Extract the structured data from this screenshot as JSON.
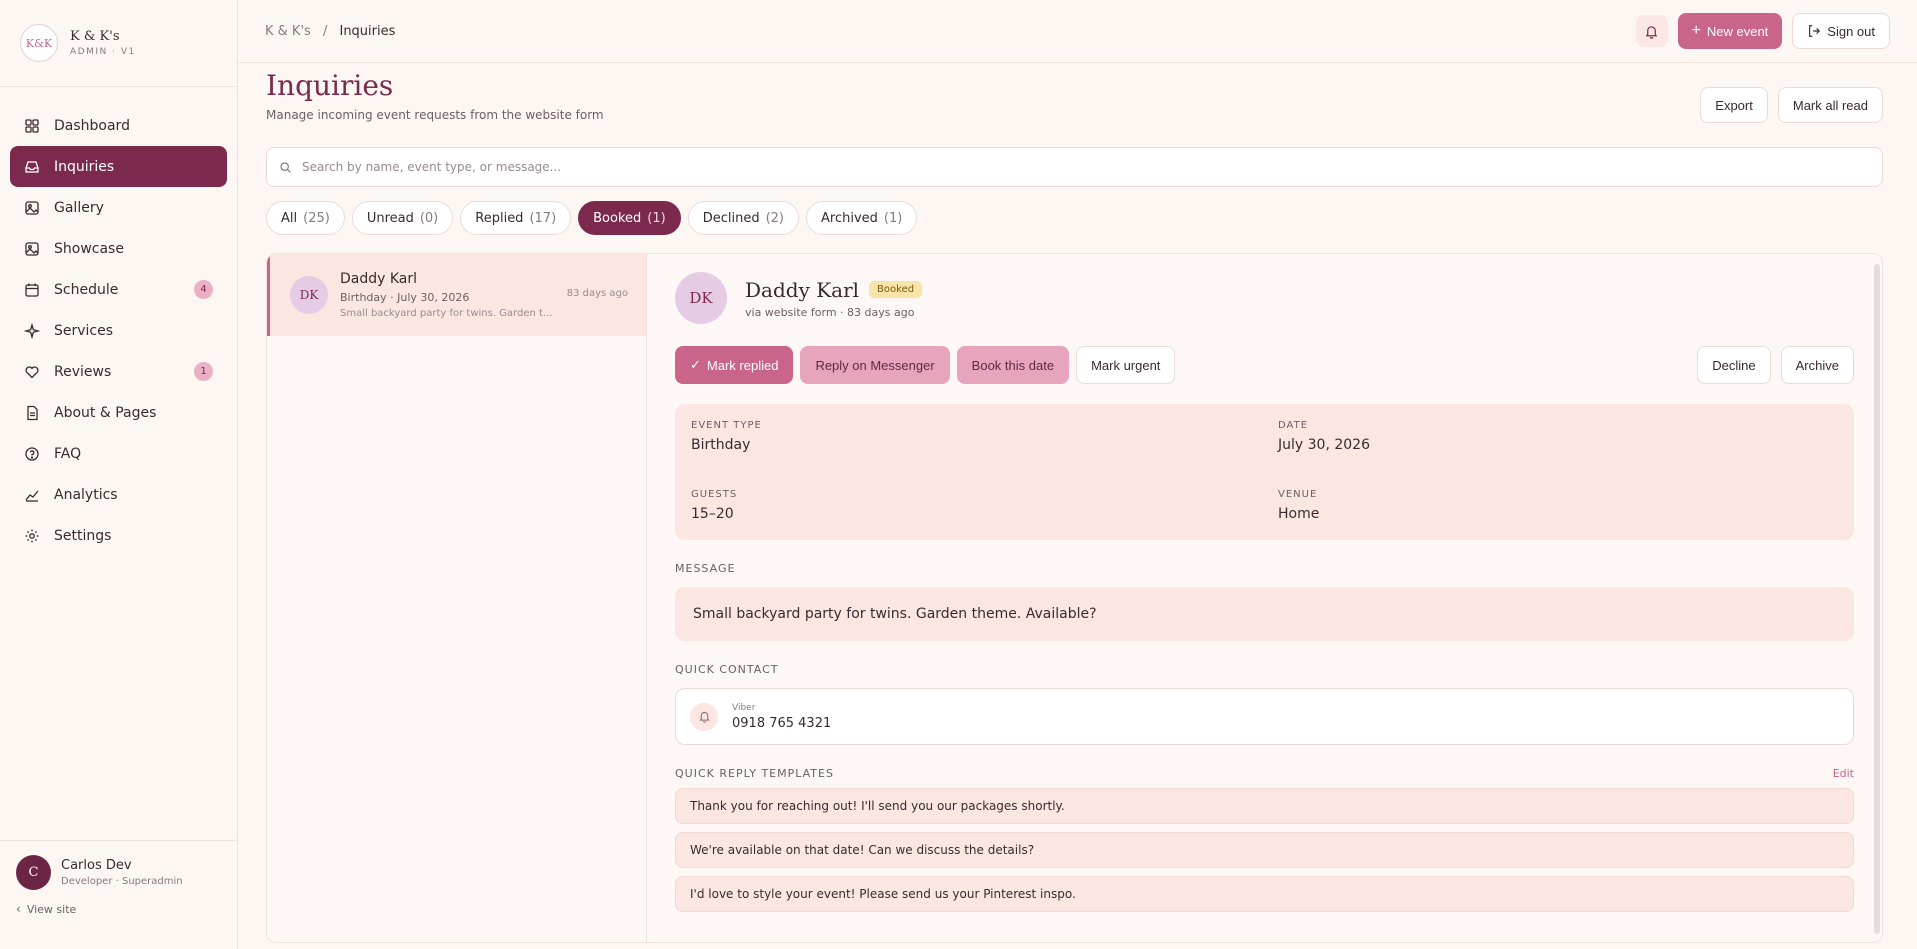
{
  "brand": {
    "name": "K & K's",
    "subtitle": "ADMIN · V1",
    "logo_text": "K&K"
  },
  "sidebar": {
    "items": [
      {
        "label": "Dashboard",
        "icon": "dashboard-icon"
      },
      {
        "label": "Inquiries",
        "icon": "inbox-icon",
        "active": true
      },
      {
        "label": "Gallery",
        "icon": "image-icon"
      },
      {
        "label": "Showcase",
        "icon": "image-icon"
      },
      {
        "label": "Schedule",
        "icon": "calendar-icon",
        "badge": "4"
      },
      {
        "label": "Services",
        "icon": "sparkle-icon"
      },
      {
        "label": "Reviews",
        "icon": "heart-icon",
        "badge": "1"
      },
      {
        "label": "About & Pages",
        "icon": "document-icon"
      },
      {
        "label": "FAQ",
        "icon": "help-icon"
      },
      {
        "label": "Analytics",
        "icon": "chart-icon"
      },
      {
        "label": "Settings",
        "icon": "gear-icon"
      }
    ],
    "user": {
      "initial": "C",
      "name": "Carlos Dev",
      "role": "Developer · Superadmin"
    },
    "view_site": "View site"
  },
  "topbar": {
    "breadcrumb_root": "K & K's",
    "breadcrumb_sep": "/",
    "breadcrumb_current": "Inquiries",
    "new_event": "New event",
    "sign_out": "Sign out"
  },
  "page": {
    "title": "Inquiries",
    "subtitle": "Manage incoming event requests from the website form",
    "export": "Export",
    "mark_all_read": "Mark all read"
  },
  "search": {
    "placeholder": "Search by name, event type, or message..."
  },
  "filters": [
    {
      "label": "All",
      "count": "(25)"
    },
    {
      "label": "Unread",
      "count": "(0)"
    },
    {
      "label": "Replied",
      "count": "(17)"
    },
    {
      "label": "Booked",
      "count": "(1)",
      "active": true
    },
    {
      "label": "Declined",
      "count": "(2)"
    },
    {
      "label": "Archived",
      "count": "(1)"
    }
  ],
  "inquiry_list": [
    {
      "initials": "DK",
      "name": "Daddy Karl",
      "meta": "Birthday · July 30, 2026",
      "snippet": "Small backyard party for twins. Garden t...",
      "time": "83 days ago"
    }
  ],
  "detail": {
    "initials": "DK",
    "name": "Daddy Karl",
    "status": "Booked",
    "via": "via website form · 83 days ago",
    "actions": {
      "mark_replied": "Mark replied",
      "reply_messenger": "Reply on Messenger",
      "book_date": "Book this date",
      "mark_urgent": "Mark urgent",
      "decline": "Decline",
      "archive": "Archive"
    },
    "info": {
      "event_type_label": "EVENT TYPE",
      "event_type": "Birthday",
      "date_label": "DATE",
      "date": "July 30, 2026",
      "guests_label": "GUESTS",
      "guests": "15–20",
      "venue_label": "VENUE",
      "venue": "Home"
    },
    "message_label": "MESSAGE",
    "message": "Small backyard party for twins. Garden theme. Available?",
    "contact_label": "QUICK CONTACT",
    "contact": {
      "type": "Viber",
      "value": "0918 765 4321"
    },
    "templates_label": "QUICK REPLY TEMPLATES",
    "templates_edit": "Edit",
    "templates": [
      "Thank you for reaching out! I'll send you our packages shortly.",
      "We're available on that date! Can we discuss the details?",
      "I'd love to style your event! Please send us your Pinterest inspo."
    ]
  },
  "colors": {
    "accent": "#7b2a4e",
    "primary_button": "#c9648a",
    "soft_pink": "#fbe6e2",
    "badge_booked": "#f8e4a6"
  }
}
